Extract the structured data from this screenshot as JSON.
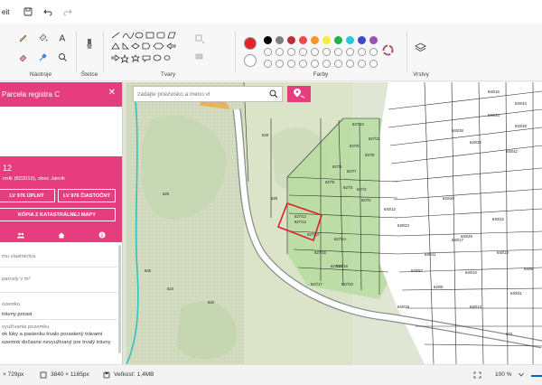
{
  "app": {
    "title_fragment": "eit"
  },
  "ribbon": {
    "groups": {
      "tools": "Nástroje",
      "brushes": "Štetce",
      "shapes": "Tvary",
      "colors": "Farby",
      "layers": "Vrstvy"
    }
  },
  "palette": {
    "primary": "#e0242b",
    "secondary": "#ffffff",
    "row1": [
      "#000000",
      "#7f7f7f",
      "#b83232",
      "#f0484d",
      "#f7932a",
      "#f6ee3a",
      "#22b14c",
      "#29c9d8",
      "#3f48cc",
      "#9b52b8"
    ],
    "row2_empty_count": 10
  },
  "search": {
    "placeholder": "zadajte priezvisko a meno vl"
  },
  "panel": {
    "title": "Parcela registra C",
    "parcel_number": "12",
    "cadastre": "nník (822019), obec Jarník",
    "btn_lv_full": "LV 976 ÚPLNÝ",
    "btn_lv_partial": "LV 976 ČIASTOČNÝ",
    "btn_copy_map": "KÓPIA Z KATASTRÁLNEJ MAPY",
    "lines": [
      {
        "text": "mu vlastníctva",
        "muted": true
      },
      {
        "text": "parcely v m²",
        "muted": true
      },
      {
        "text": "ozemku",
        "muted": true
      },
      {
        "text": "trávny porast",
        "muted": false
      },
      {
        "text": "využívania pozemku",
        "muted": true
      },
      {
        "text": "ok lúky a pasienku trvalo porastený trávami",
        "muted": false
      },
      {
        "text": "ozemok dočasne nevyužívaný pre trvalý trávny",
        "muted": false
      }
    ]
  },
  "map": {
    "labels": [
      "627/10",
      "627/11",
      "627/9",
      "627/8",
      "627/6",
      "627/7",
      "627/5",
      "627/4",
      "627/3",
      "627/2",
      "627/12",
      "627/13",
      "627/14",
      "627/15",
      "627/16",
      "627/17",
      "627/18",
      "627/20",
      "640/16",
      "640/44",
      "640/34",
      "640/39",
      "640/38",
      "640/35",
      "640/42",
      "640/12",
      "640/23",
      "640/30",
      "640/22",
      "640/25",
      "640/17",
      "640/18",
      "640/11",
      "640/10",
      "640/8",
      "640/5",
      "640/67",
      "640/31",
      "640/19",
      "640/13",
      "628",
      "629",
      "626",
      "625",
      "624",
      "620",
      "673"
    ],
    "selected_parcel": "627/12"
  },
  "status": {
    "dimensions": "× 729px",
    "image_size": "3840 × 1165px",
    "file_size": "Veľkosť: 1,4MB",
    "zoom": "100 %"
  }
}
